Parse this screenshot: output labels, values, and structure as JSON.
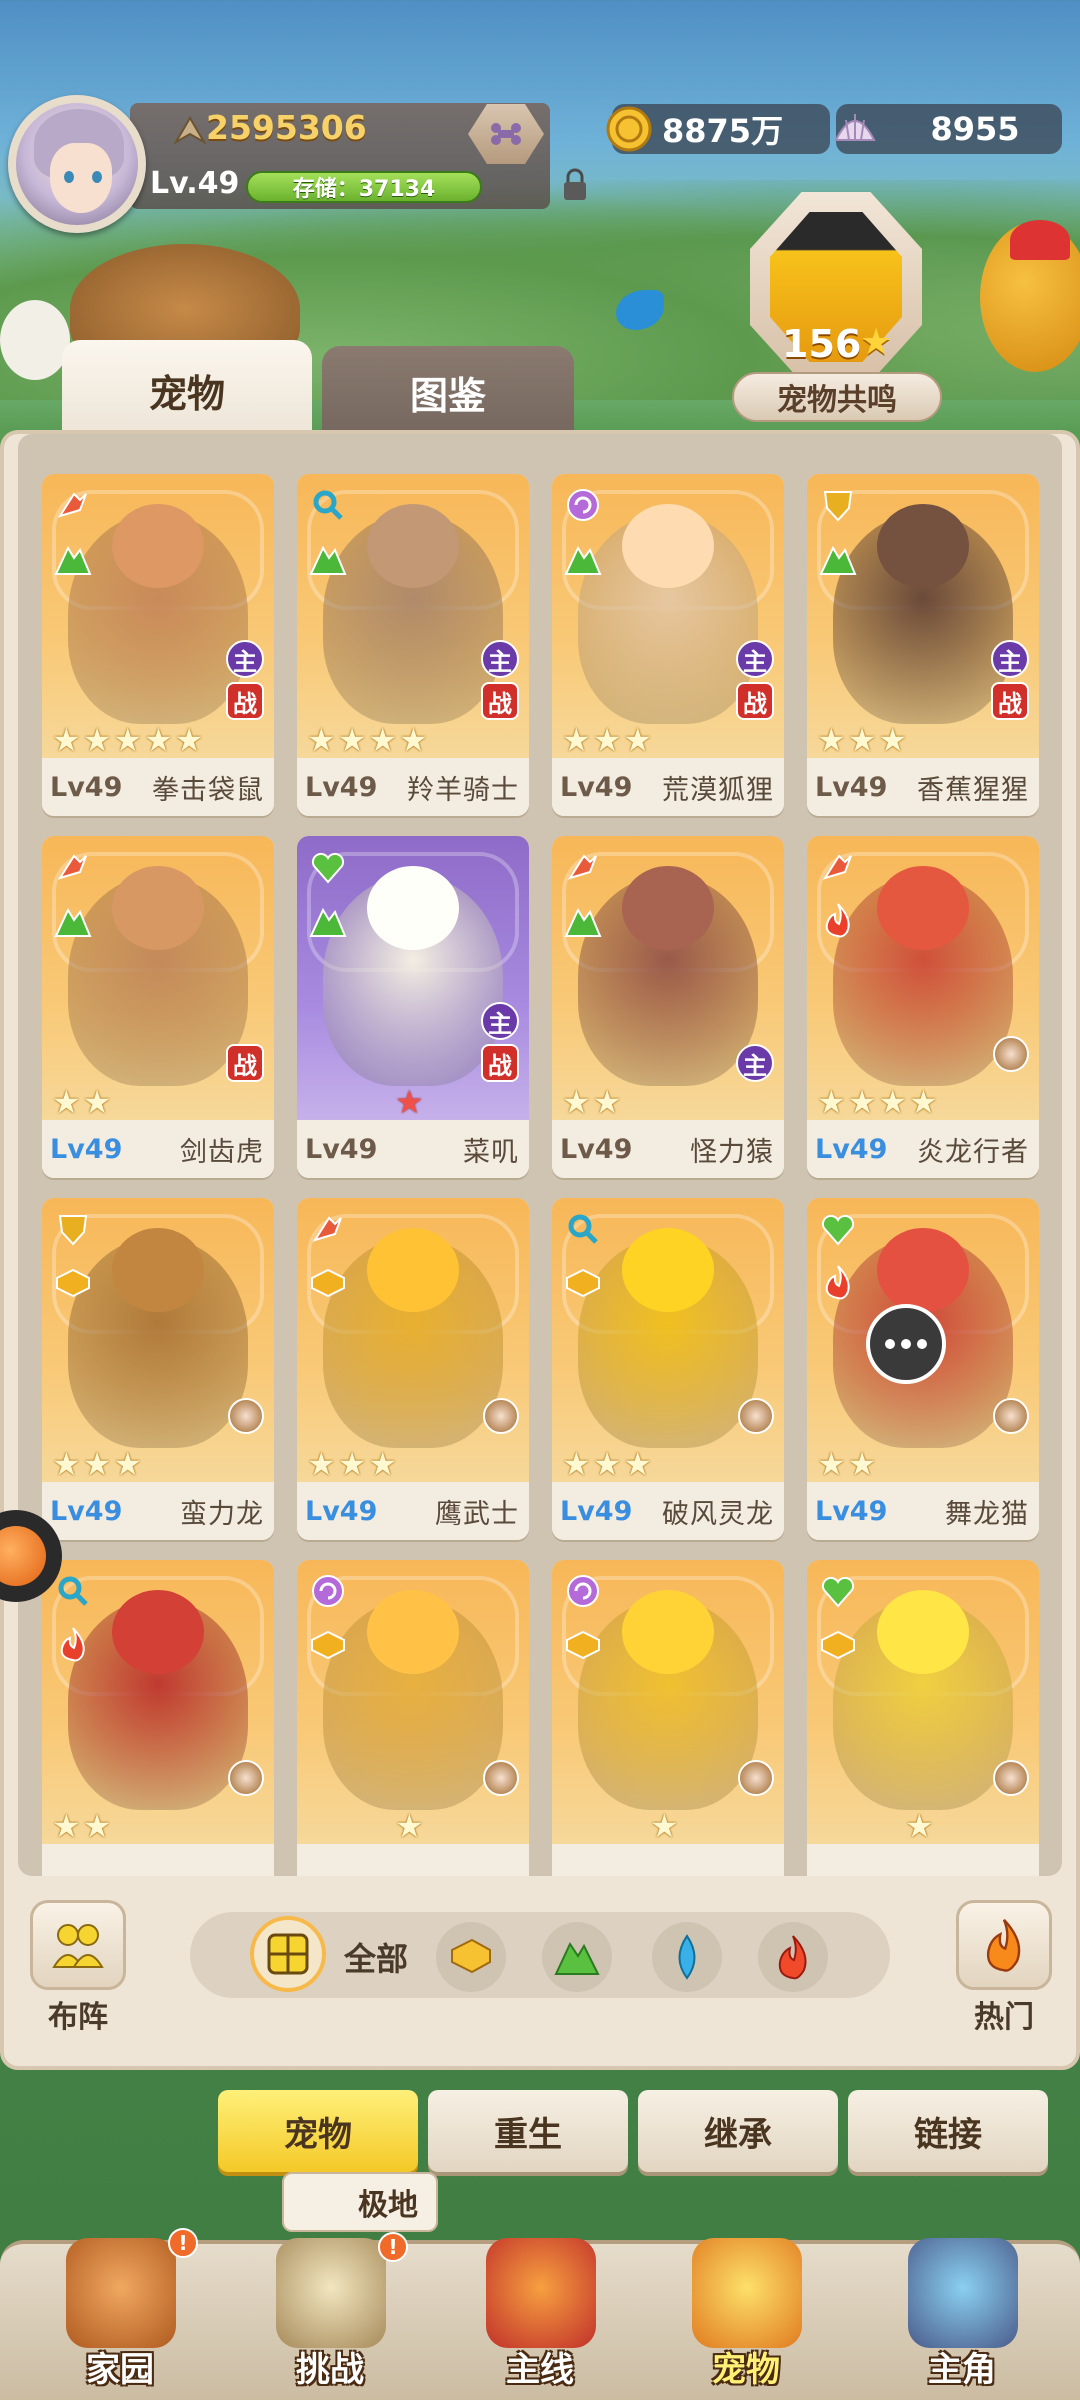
{
  "header": {
    "power": "2595306",
    "level": "Lv.49",
    "storage": "存储：37134",
    "gold": "8875万",
    "shells": "8955"
  },
  "resonance": {
    "count": "156",
    "label": "宠物共鸣"
  },
  "tabs": [
    {
      "label": "宠物",
      "active": true
    },
    {
      "label": "图鉴",
      "active": false
    }
  ],
  "pets": [
    {
      "level": "Lv49",
      "name": "拳击袋鼠",
      "stars": 5,
      "class": "attack",
      "element": "grass",
      "main": true,
      "battle": true
    },
    {
      "level": "Lv49",
      "name": "羚羊骑士",
      "stars": 4,
      "class": "magic",
      "element": "grass",
      "main": true,
      "battle": true
    },
    {
      "level": "Lv49",
      "name": "荒漠狐狸",
      "stars": 3,
      "class": "arcane",
      "element": "grass",
      "main": true,
      "battle": true
    },
    {
      "level": "Lv49",
      "name": "香蕉猩猩",
      "stars": 3,
      "class": "defense",
      "element": "grass",
      "main": true,
      "battle": true
    },
    {
      "level": "Lv49",
      "name": "剑齿虎",
      "stars": 2,
      "class": "attack",
      "element": "grass",
      "main": false,
      "battle": true
    },
    {
      "level": "Lv49",
      "name": "菜叽",
      "stars": 1,
      "class": "heal",
      "element": "grass",
      "main": true,
      "battle": true
    },
    {
      "level": "Lv49",
      "name": "怪力猿",
      "stars": 2,
      "class": "attack",
      "element": "grass",
      "main": true,
      "battle": false
    },
    {
      "level": "Lv49",
      "name": "炎龙行者",
      "stars": 4,
      "class": "attack",
      "element": "fire",
      "main": false,
      "battle": false
    },
    {
      "level": "Lv49",
      "name": "蛮力龙",
      "stars": 3,
      "class": "defense",
      "element": "earth",
      "main": false,
      "battle": false
    },
    {
      "level": "Lv49",
      "name": "鹰武士",
      "stars": 3,
      "class": "attack",
      "element": "earth",
      "main": false,
      "battle": false
    },
    {
      "level": "Lv49",
      "name": "破风灵龙",
      "stars": 3,
      "class": "magic",
      "element": "earth",
      "main": false,
      "battle": false
    },
    {
      "level": "Lv49",
      "name": "舞龙猫",
      "stars": 2,
      "class": "heal",
      "element": "fire",
      "main": false,
      "battle": false
    },
    {
      "level": "",
      "name": "",
      "stars": 2,
      "class": "magic",
      "element": "fire",
      "main": false,
      "battle": false
    },
    {
      "level": "",
      "name": "",
      "stars": 1,
      "class": "arcane",
      "element": "earth",
      "main": false,
      "battle": false
    },
    {
      "level": "",
      "name": "",
      "stars": 1,
      "class": "arcane",
      "element": "earth",
      "main": false,
      "battle": false
    },
    {
      "level": "",
      "name": "",
      "stars": 1,
      "class": "heal",
      "element": "earth",
      "main": false,
      "battle": false
    }
  ],
  "badges": {
    "main": "主",
    "battle": "战"
  },
  "filter": {
    "formation": "布阵",
    "all": "全部",
    "hot": "热门"
  },
  "actions": [
    "宠物",
    "重生",
    "继承",
    "链接"
  ],
  "tooltip": "极地",
  "nav": [
    "家园",
    "挑战",
    "主线",
    "宠物",
    "主角"
  ],
  "notif": "!",
  "colors": {
    "card_gold": "#f7b758",
    "card_purple": "#8e6bc8",
    "level_blue": "#3a8ee0",
    "attack": "#e85a3a",
    "magic": "#2aa6c8",
    "arcane": "#b46ad8",
    "defense": "#e8b020",
    "heal": "#5ac040",
    "grass": "#4cb83a",
    "fire": "#e8402a",
    "earth": "#f0b020"
  }
}
